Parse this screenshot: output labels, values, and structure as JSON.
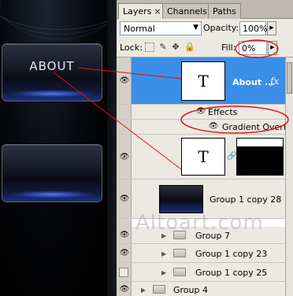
{
  "canvas": {
    "button_label": "ABOUT"
  },
  "panel": {
    "tabs": [
      {
        "label": "Layers",
        "close": "×",
        "active": true
      },
      {
        "label": "Channels",
        "active": false
      },
      {
        "label": "Paths",
        "active": false
      }
    ],
    "blend_mode": "Normal",
    "opacity_label": "Opacity:",
    "opacity_value": "100%",
    "lock_label": "Lock:",
    "fill_label": "Fill:",
    "fill_value": "0%"
  },
  "layers": [
    {
      "name": "About ...",
      "type": "text",
      "thumb_glyph": "T",
      "selected": true,
      "fx": "fx"
    },
    {
      "name": "Effects",
      "type": "effects"
    },
    {
      "name": "Gradient Overlay",
      "type": "effect-item"
    },
    {
      "name": "",
      "type": "text-with-mask",
      "thumb_glyph": "T"
    },
    {
      "name": "Group 1 copy 28",
      "type": "image"
    },
    {
      "name": "Group 7",
      "type": "group"
    },
    {
      "name": "Group 1 copy 23",
      "type": "group"
    },
    {
      "name": "Group 1 copy 25",
      "type": "group"
    },
    {
      "name": "Group 4",
      "type": "group"
    }
  ],
  "watermark": "Altoart.com",
  "colors": {
    "selected_row": "#3a8ee6",
    "annotation_red": "#e01010",
    "panel_bg": "#d4d0c8"
  }
}
